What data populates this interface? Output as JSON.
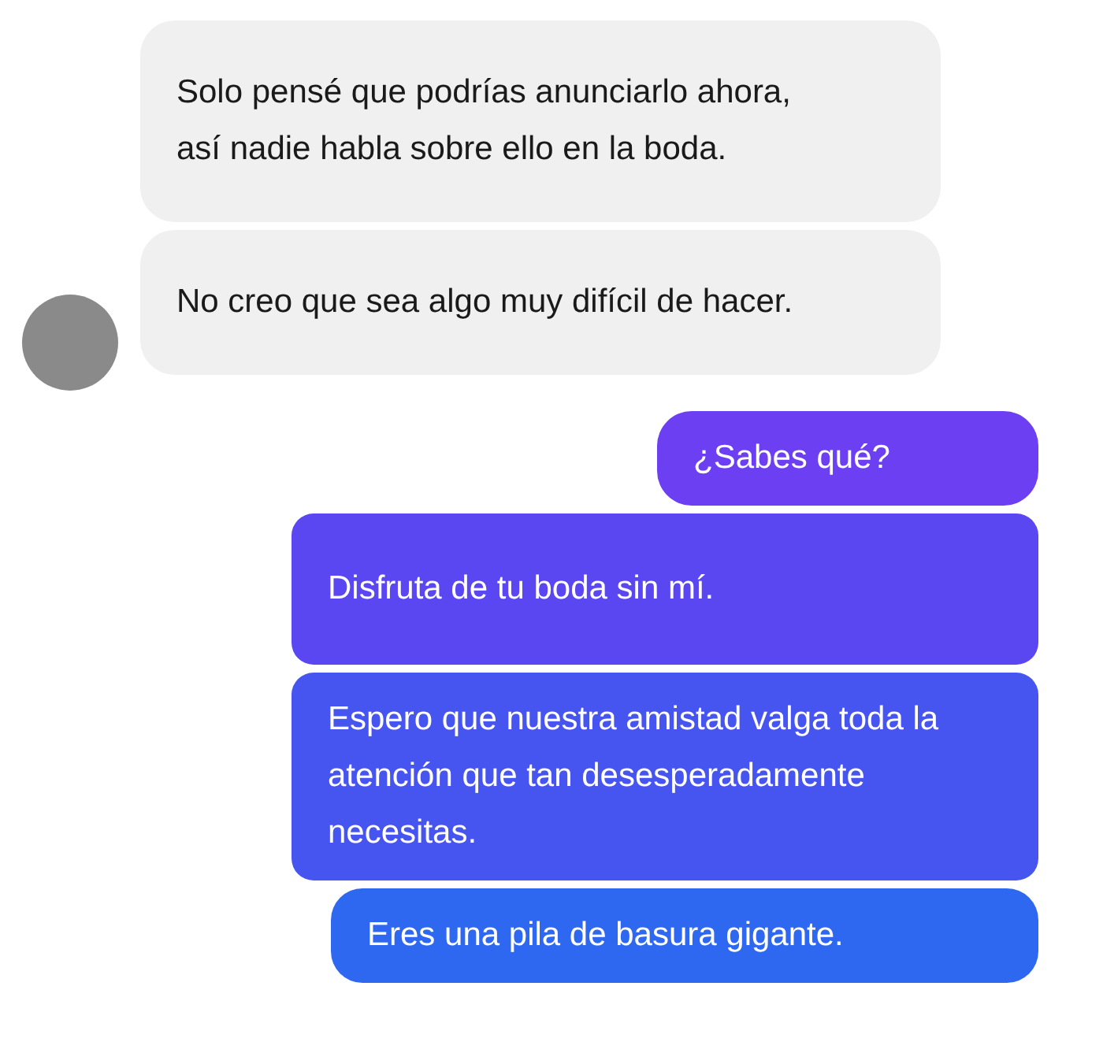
{
  "messages": [
    {
      "kind": "incoming",
      "text": "Solo pensé que podrías anunciarlo ahora, así nadie habla sobre ello en la boda."
    },
    {
      "kind": "incoming",
      "text": "No creo que sea algo muy difícil de hacer."
    },
    {
      "kind": "outgoing",
      "text": "¿Sabes qué?"
    },
    {
      "kind": "outgoing",
      "text": "Disfruta de tu boda sin mí."
    },
    {
      "kind": "outgoing",
      "text": "Espero que nuestra amistad valga toda la atención que tan desesperadamente necesitas."
    },
    {
      "kind": "outgoing",
      "text": "Eres una pila de basura gigante."
    }
  ]
}
